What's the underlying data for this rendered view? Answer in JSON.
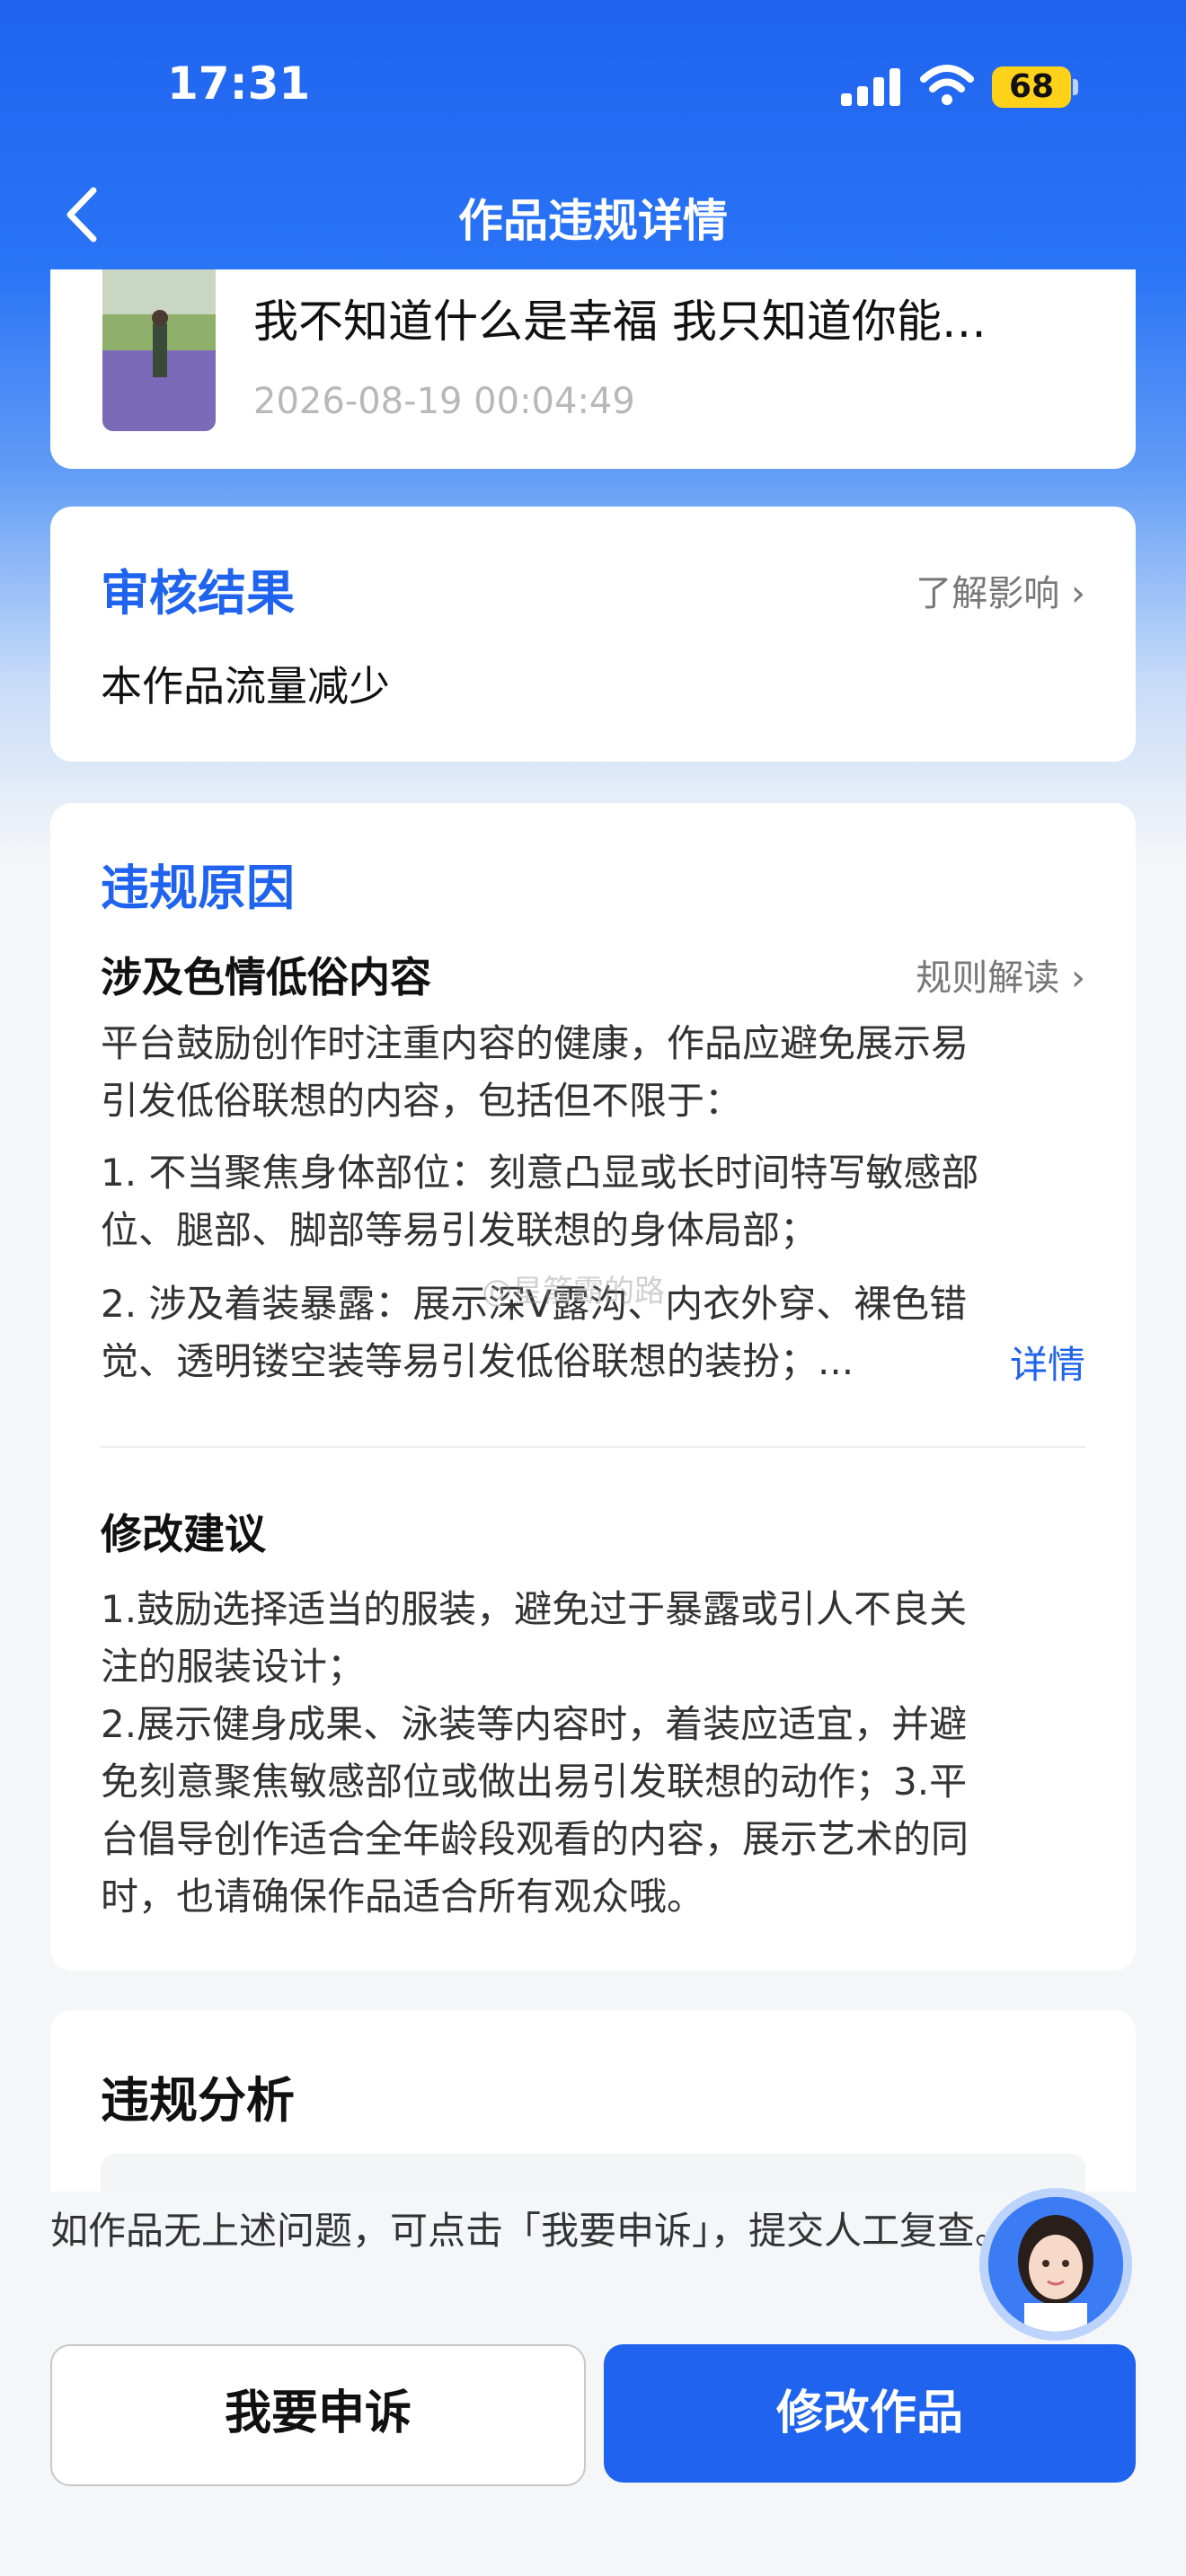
{
  "status_bar": {
    "time": "17:31",
    "battery": "68"
  },
  "nav": {
    "title": "作品违规详情"
  },
  "work": {
    "title": "我不知道什么是幸福 我只知道你能…",
    "time": "2026-08-19 00:04:49"
  },
  "review": {
    "title": "审核结果",
    "link": "了解影响 ›",
    "result": "本作品流量减少"
  },
  "violation": {
    "title": "违规原因",
    "category": "涉及色情低俗内容",
    "link": "规则解读 ›",
    "intro_line1": "平台鼓励创作时注重内容的健康，作品应避免展示易",
    "intro_line2": "引发低俗联想的内容，包括但不限于：",
    "item1_line1": "1. 不当聚焦身体部位：刻意凸显或长时间特写敏感部",
    "item1_line2": "位、腿部、脚部等易引发联想的身体局部；",
    "item2_line1": "2. 涉及着装暴露：展示深V露沟、内衣外穿、裸色错",
    "item2_line2": "觉、透明镂空装等易引发低俗联想的装扮；...",
    "detail_link": "详情"
  },
  "suggestion": {
    "title": "修改建议",
    "lines": [
      "1.鼓励选择适当的服装，避免过于暴露或引人不良关",
      "注的服装设计；",
      "2.展示健身成果、泳装等内容时，着装应适宜，并避",
      "免刻意聚焦敏感部位或做出易引发联想的动作；3.平",
      "台倡导创作适合全年龄段观看的内容，展示艺术的同",
      "时，也请确保作品适合所有观众哦。"
    ]
  },
  "analysis": {
    "title": "违规分析"
  },
  "footer": {
    "note": "如作品无上述问题，可点击「我要申诉」，提交人工复查。",
    "appeal_button": "我要申诉",
    "edit_button": "修改作品"
  },
  "watermark": "@星箭霸的路",
  "colors": {
    "accent": "#1f63ee",
    "battery": "#ffd21a"
  }
}
